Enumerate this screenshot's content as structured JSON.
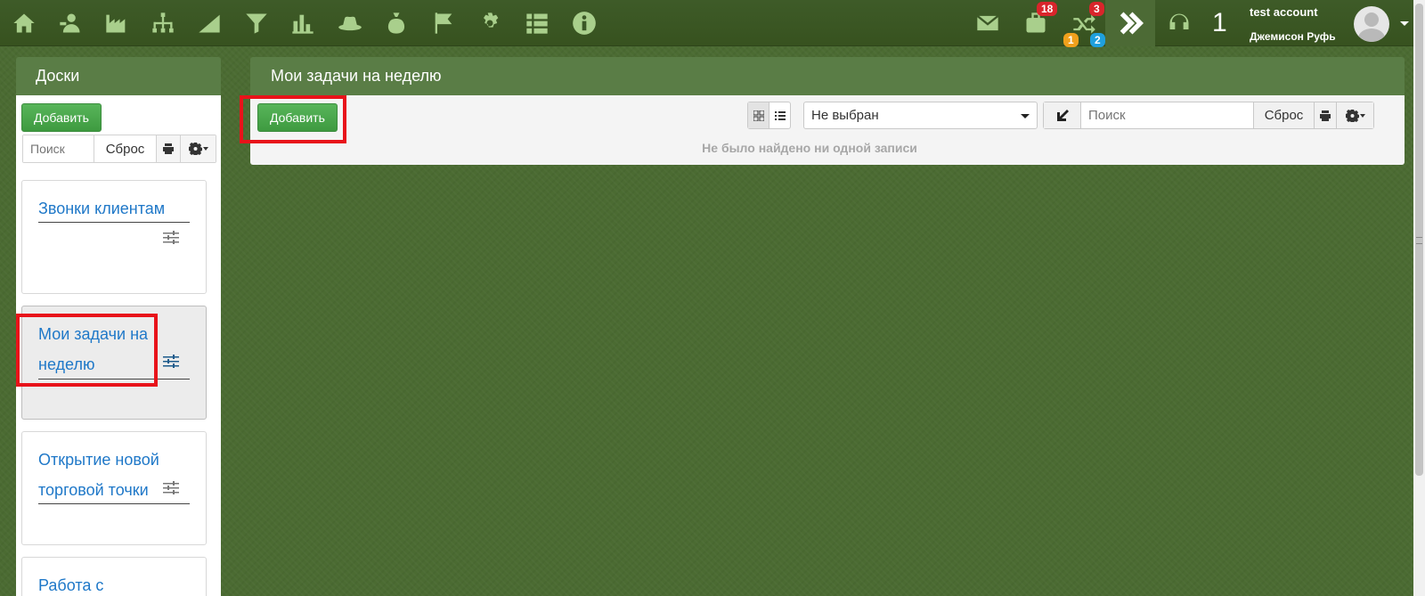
{
  "topbar": {
    "nav_icons": [
      "home-icon",
      "contacts-icon",
      "factory-icon",
      "org-structure-icon",
      "area-chart-icon",
      "funnel-icon",
      "bar-chart-icon",
      "hat-icon",
      "money-bag-icon",
      "flag-icon",
      "gear-icon",
      "list-icon",
      "info-icon"
    ],
    "mail_icon": "mail-icon",
    "briefcase_badge": "18",
    "shuffle_badge_top": "3",
    "shuffle_badge_bottom_left": "1",
    "shuffle_badge_bottom_right": "2",
    "count": "1",
    "user_name": "test account",
    "user_sub": "Джемисон Руфь",
    "colors": {
      "bar": "#3b5726",
      "icon": "#a9cf8c",
      "badge_red": "#d9252b",
      "badge_orange": "#f0a01c",
      "badge_blue": "#1fa0dd"
    }
  },
  "boards": {
    "title": "Доски",
    "add_label": "Добавить",
    "search_placeholder": "Поиск",
    "reset_label": "Сброс",
    "items": [
      {
        "title": "Звонки клиентам",
        "active": false
      },
      {
        "title": "Мои задачи на неделю",
        "active": true
      },
      {
        "title": "Открытие новой торговой точки",
        "active": false
      },
      {
        "title": "Работа с",
        "active": false
      }
    ]
  },
  "main": {
    "title": "Мои задачи на неделю",
    "add_label": "Добавить",
    "select_value": "Не выбран",
    "search_placeholder": "Поиск",
    "reset_label": "Сброс",
    "empty_message": "Не было найдено ни одной записи"
  }
}
